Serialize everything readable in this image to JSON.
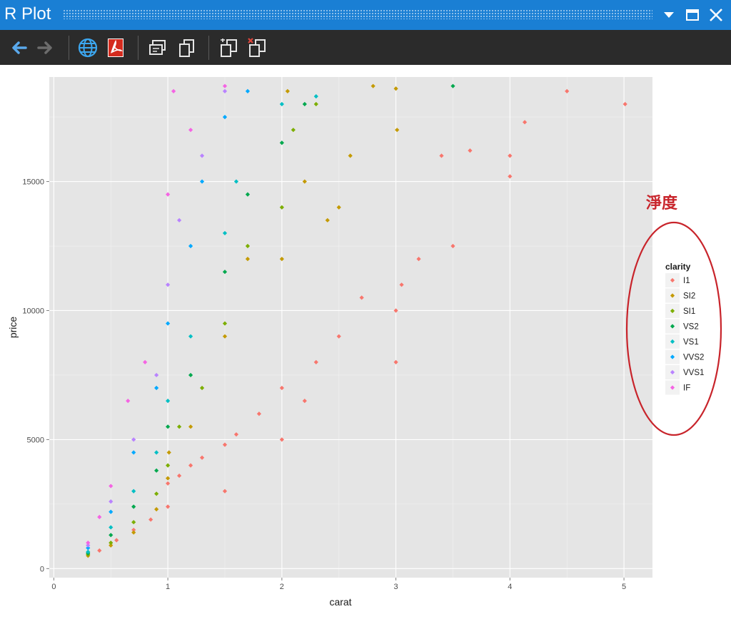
{
  "window": {
    "title": "R Plot",
    "controls": [
      "dropdown",
      "maximize",
      "close"
    ]
  },
  "toolbar": {
    "buttons": [
      {
        "name": "back",
        "icon": "arrow-left-icon"
      },
      {
        "name": "forward",
        "icon": "arrow-right-icon"
      },
      {
        "name": "browser",
        "icon": "globe-icon"
      },
      {
        "name": "pdf",
        "icon": "pdf-icon"
      },
      {
        "name": "copy-bitmap",
        "icon": "copy-window-icon"
      },
      {
        "name": "copy-metafile",
        "icon": "copy-pages-icon"
      },
      {
        "name": "previous-plot",
        "icon": "plot-history-icon"
      },
      {
        "name": "delete-plot",
        "icon": "delete-plot-icon"
      }
    ]
  },
  "annotation": {
    "label": "淨度",
    "color": "#c8242b"
  },
  "colors": {
    "titlebar": "#1a7fd4",
    "toolbar": "#2b2b2b",
    "panel": "#e5e5e5"
  },
  "chart_data": {
    "type": "scatter",
    "title": "",
    "xlabel": "carat",
    "ylabel": "price",
    "xlim": [
      -0.04,
      5.25
    ],
    "ylim": [
      -350,
      19050
    ],
    "x_ticks": [
      0,
      1,
      2,
      3,
      4,
      5
    ],
    "y_ticks": [
      0,
      5000,
      10000,
      15000
    ],
    "x_tick_labels": [
      "0",
      "1",
      "2",
      "3",
      "4",
      "5"
    ],
    "y_tick_labels": [
      "0",
      "5000",
      "10000",
      "15000"
    ],
    "grid": true,
    "legend": {
      "title": "clarity",
      "position": "right",
      "entries": [
        {
          "label": "I1",
          "color": "#F8766D"
        },
        {
          "label": "SI2",
          "color": "#C49A00"
        },
        {
          "label": "SI1",
          "color": "#7CAE00"
        },
        {
          "label": "VS2",
          "color": "#00A84E"
        },
        {
          "label": "VS1",
          "color": "#00BFC4"
        },
        {
          "label": "VVS2",
          "color": "#00A9FF"
        },
        {
          "label": "VVS1",
          "color": "#B983FF"
        },
        {
          "label": "IF",
          "color": "#F564E3"
        }
      ]
    },
    "series": [
      {
        "name": "I1",
        "x": [
          0.4,
          0.55,
          0.7,
          0.85,
          1.0,
          1.0,
          1.1,
          1.2,
          1.3,
          1.5,
          1.5,
          1.6,
          1.8,
          2.0,
          2.0,
          2.2,
          2.3,
          2.5,
          2.7,
          3.0,
          3.0,
          3.05,
          3.2,
          3.4,
          3.5,
          3.65,
          4.0,
          4.0,
          4.13,
          4.5,
          5.01
        ],
        "y": [
          700,
          1100,
          1500,
          1900,
          2400,
          3300,
          3600,
          4000,
          4300,
          3000,
          4800,
          5200,
          6000,
          5000,
          7000,
          6500,
          8000,
          9000,
          10500,
          8000,
          10000,
          11000,
          12000,
          16000,
          12500,
          16200,
          16000,
          15200,
          17300,
          18500,
          18000
        ]
      },
      {
        "name": "SI2",
        "x": [
          0.3,
          0.5,
          0.7,
          0.9,
          1.0,
          1.01,
          1.2,
          1.5,
          1.7,
          2.0,
          2.05,
          2.2,
          2.4,
          2.5,
          2.6,
          2.8,
          3.0,
          3.01
        ],
        "y": [
          500,
          900,
          1400,
          2300,
          3500,
          4500,
          5500,
          9000,
          12000,
          12000,
          18500,
          15000,
          13500,
          14000,
          16000,
          18700,
          18600,
          17000
        ]
      },
      {
        "name": "SI1",
        "x": [
          0.3,
          0.5,
          0.7,
          0.9,
          1.0,
          1.1,
          1.3,
          1.5,
          1.7,
          2.0,
          2.1,
          2.3
        ],
        "y": [
          550,
          1000,
          1800,
          2900,
          4000,
          5500,
          7000,
          9500,
          12500,
          14000,
          17000,
          18000
        ]
      },
      {
        "name": "VS2",
        "x": [
          0.3,
          0.5,
          0.7,
          0.9,
          1.0,
          1.2,
          1.5,
          1.7,
          2.0,
          2.2,
          3.5
        ],
        "y": [
          600,
          1300,
          2400,
          3800,
          5500,
          7500,
          11500,
          14500,
          16500,
          18000,
          18700
        ]
      },
      {
        "name": "VS1",
        "x": [
          0.3,
          0.5,
          0.7,
          0.9,
          1.0,
          1.2,
          1.5,
          1.6,
          2.0,
          2.3
        ],
        "y": [
          650,
          1600,
          3000,
          4500,
          6500,
          9000,
          13000,
          15000,
          18000,
          18300
        ]
      },
      {
        "name": "VVS2",
        "x": [
          0.3,
          0.5,
          0.7,
          0.9,
          1.0,
          1.2,
          1.3,
          1.5,
          1.7
        ],
        "y": [
          800,
          2200,
          4500,
          7000,
          9500,
          12500,
          15000,
          17500,
          18500
        ]
      },
      {
        "name": "VVS1",
        "x": [
          0.3,
          0.5,
          0.7,
          0.9,
          1.0,
          1.1,
          1.3,
          1.5
        ],
        "y": [
          900,
          2600,
          5000,
          7500,
          11000,
          13500,
          16000,
          18500
        ]
      },
      {
        "name": "IF",
        "x": [
          0.3,
          0.4,
          0.5,
          0.65,
          0.8,
          1.0,
          1.05,
          1.2,
          1.5
        ],
        "y": [
          1000,
          2000,
          3200,
          6500,
          8000,
          14500,
          18500,
          17000,
          18700
        ]
      }
    ]
  }
}
